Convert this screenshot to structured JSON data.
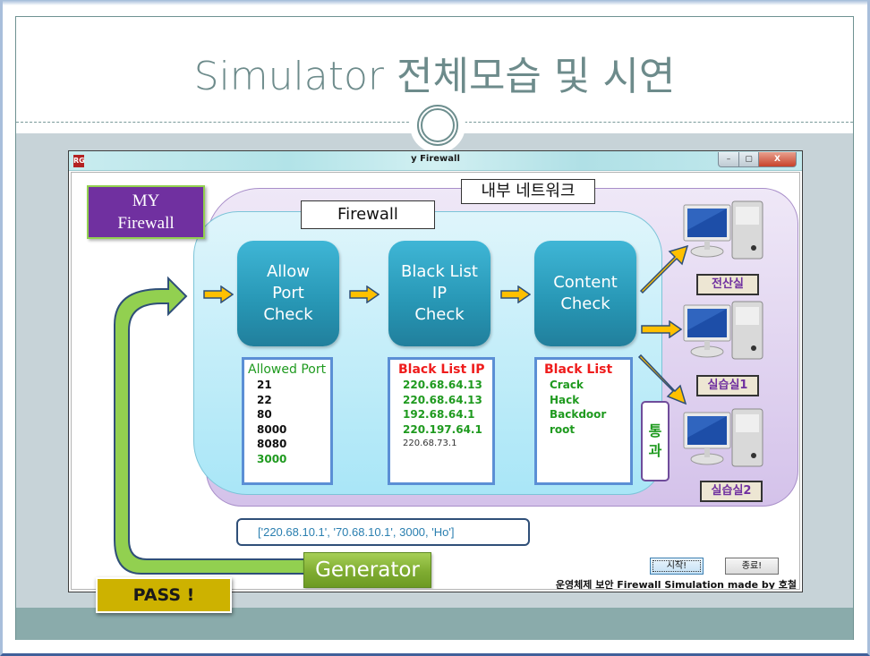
{
  "slide": {
    "title": "Simulator 전체모습 및 시연"
  },
  "window": {
    "title": "y Firewall",
    "app_icon": "RG",
    "controls": {
      "minimize": "–",
      "maximize": "▢",
      "close": "X"
    }
  },
  "diagram": {
    "my_firewall_label": "MY Firewall",
    "my_firewall_line1": "MY",
    "my_firewall_line2": "Firewall",
    "inner_network_label": "내부 네트워크",
    "firewall_label": "Firewall",
    "checks": [
      {
        "lines": [
          "Allow",
          "Port",
          "Check"
        ]
      },
      {
        "lines": [
          "Black List",
          "IP",
          "Check"
        ]
      },
      {
        "lines": [
          "Content",
          "Check"
        ]
      }
    ],
    "allowed_port": {
      "header": "Allowed Port",
      "items": [
        "21",
        "22",
        "80",
        "8000",
        "8080",
        "3000"
      ],
      "highlighted": "3000"
    },
    "black_list_ip": {
      "header": "Black List IP",
      "items": [
        "220.68.64.13",
        "220.68.64.13",
        "192.68.64.1",
        "220.197.64.1"
      ],
      "extra": "220.68.73.1"
    },
    "black_list": {
      "header": "Black List",
      "items": [
        "Crack",
        "Hack",
        "Backdoor",
        "root"
      ]
    },
    "pass_through": [
      "통",
      "과"
    ],
    "rooms": [
      "전산실",
      "실습실1",
      "실습실2"
    ],
    "colors": {
      "check_box": "#2fa3c4",
      "purple": "#7030a0",
      "green_text": "#1f9a1f",
      "red_text": "#ef1c1c",
      "arrow_fill": "#ffc000",
      "loop_arrow": "#92d050"
    }
  },
  "controls": {
    "packet_value": "['220.68.10.1', '70.68.10.1', 3000, 'Ho']",
    "generator_label": "Generator",
    "start_label": "시작!",
    "stop_label": "종료!",
    "credit": "운영체제 보안 Firewall Simulation made by 호철"
  },
  "status": {
    "result_label": "PASS !"
  }
}
